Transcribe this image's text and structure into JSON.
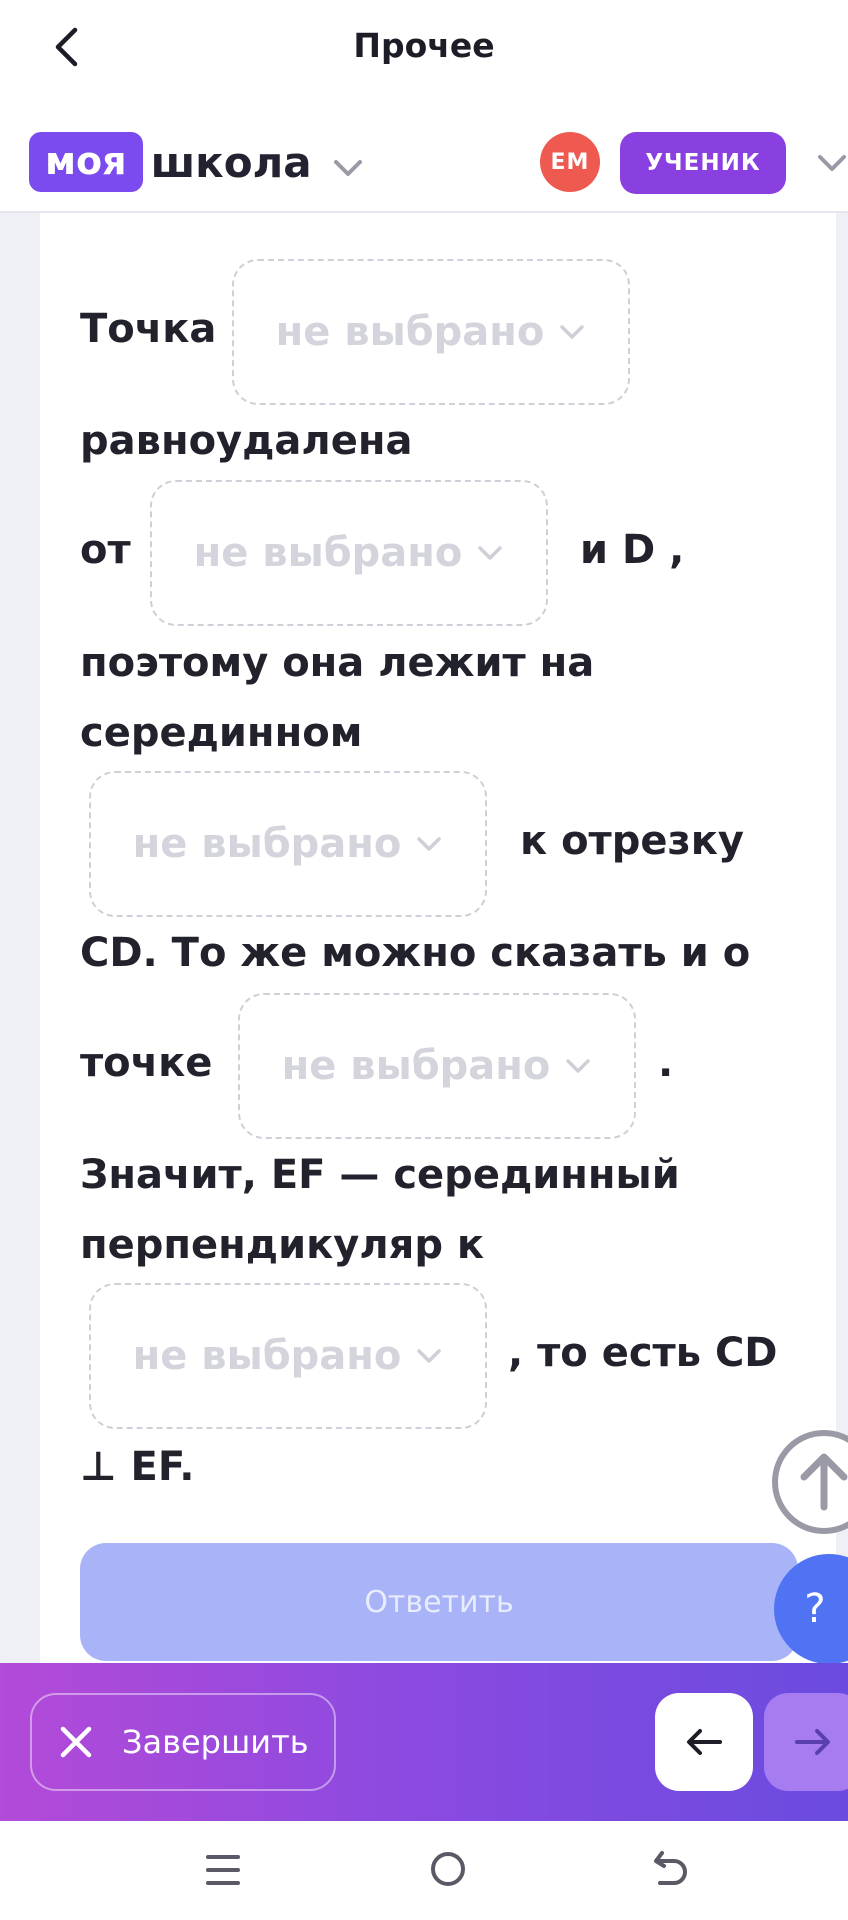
{
  "header": {
    "title": "Прочее",
    "back_icon": "chevron-left-icon"
  },
  "school_bar": {
    "logo_badge": "моя",
    "logo_text": "школа",
    "avatar_initials": "ЕМ",
    "role": "УЧЕНИК"
  },
  "task": {
    "text": {
      "t1": "Точка",
      "t2": "равноудалена",
      "t3": "от",
      "t4": "и D ,",
      "t5": "поэтому она лежит на",
      "t6": "серединном",
      "t7": "к отрезку",
      "t8": "CD. То же можно сказать и о",
      "t9": "точке",
      "t10": ".",
      "t11": "Значит, EF — серединный",
      "t12": "перпендикуляр к",
      "t13": ", то есть CD",
      "t14": "⊥ EF."
    },
    "dropdowns": [
      {
        "value": "не выбрано"
      },
      {
        "value": "не выбрано"
      },
      {
        "value": "не выбрано"
      },
      {
        "value": "не выбрано"
      },
      {
        "value": "не выбрано"
      }
    ],
    "answer_label": "Ответить",
    "help_label": "?"
  },
  "action_bar": {
    "finish_label": "Завершить"
  },
  "colors": {
    "brand": "#7b4bf0",
    "role_badge": "#8a3fe0",
    "avatar": "#ef5a50",
    "answer_disabled": "#a8b4f7",
    "help": "#4f73f3"
  }
}
